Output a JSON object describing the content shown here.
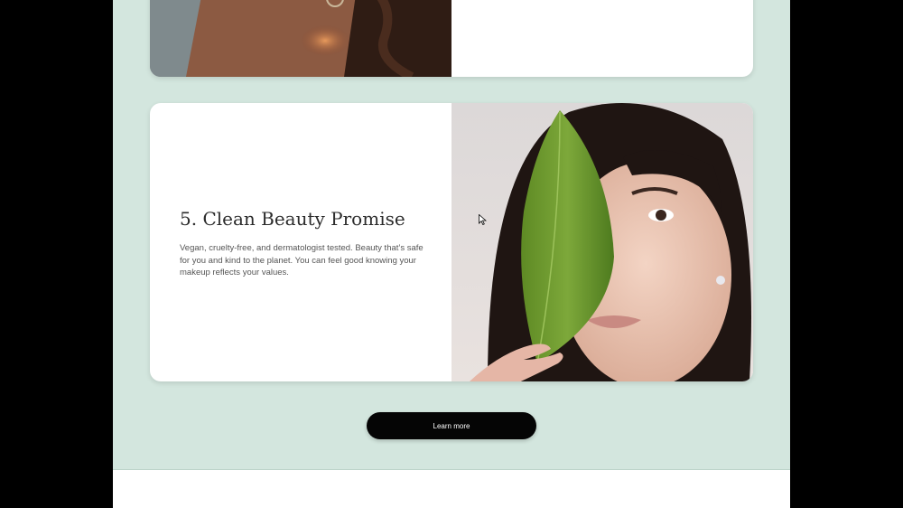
{
  "previous_card": {
    "image_alt": "portrait-curly-hair"
  },
  "feature_card": {
    "title": "5. Clean Beauty Promise",
    "description": "Vegan, cruelty-free, and dermatologist tested. Beauty that’s safe for you and kind to the planet. You can feel good knowing your makeup reflects your values.",
    "image_alt": "woman-holding-leaf"
  },
  "cta": {
    "label": "Learn more"
  },
  "colors": {
    "page_background": "#d3e6de",
    "button_background": "#050505",
    "card_background": "#ffffff"
  }
}
